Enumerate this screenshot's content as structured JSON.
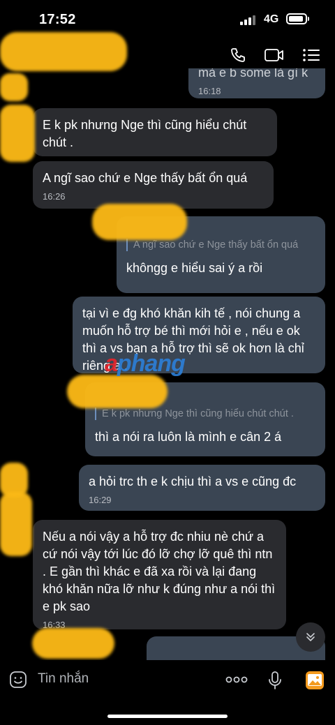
{
  "status_bar": {
    "time": "17:52",
    "network": "4G"
  },
  "messages": [
    {
      "id": "m0",
      "direction": "out",
      "text": "mà e b some là gì k",
      "time": "16:18"
    },
    {
      "id": "m1",
      "direction": "in",
      "text": "E k pk nhưng Nge thì cũng hiểu chút chút ."
    },
    {
      "id": "m2",
      "direction": "in",
      "text": "A ngĩ sao chứ e Nge thấy bất ổn quá",
      "time": "16:26"
    },
    {
      "id": "m3",
      "direction": "out",
      "quote": "A ngĩ sao chứ e Nge thấy bất ổn quá",
      "text": "khôngg e hiểu sai ý a rồi"
    },
    {
      "id": "m4",
      "direction": "out",
      "text": "tại vì e đg khó khăn kih tế , nói chung a muốn hỗ trợ bé thì mới hỏi e , nếu e ok thì a vs bạn a hỗ trợ thì sẽ ok hơn là chỉ riêng a ."
    },
    {
      "id": "m5",
      "direction": "out",
      "quote": "E k pk nhưng Nge thì cũng hiểu chút chút .",
      "text": "thì a nói ra luôn là mình e cân 2 á"
    },
    {
      "id": "m6",
      "direction": "out",
      "text": "a hỏi trc th e k chịu thì a vs e cũng đc",
      "time": "16:29"
    },
    {
      "id": "m7",
      "direction": "in",
      "text": "Nếu a nói vậy a hỗ trợ đc nhiu nè chứ a cứ nói vậy tới lúc đó lỡ chợ lỡ quê thì ntn . E gần thì khác e đã xa rồi và lại đang khó khăn nữa lỡ như k đúng như a nói thì e pk sao",
      "time": "16:33"
    }
  ],
  "watermark": {
    "prefix": "a",
    "rest": "phang"
  },
  "composer": {
    "placeholder": "Tin nhắn"
  },
  "colors": {
    "incoming": "#2a2b2f",
    "outgoing": "#3a4553",
    "background": "#000000",
    "censor": "#fbb916"
  }
}
